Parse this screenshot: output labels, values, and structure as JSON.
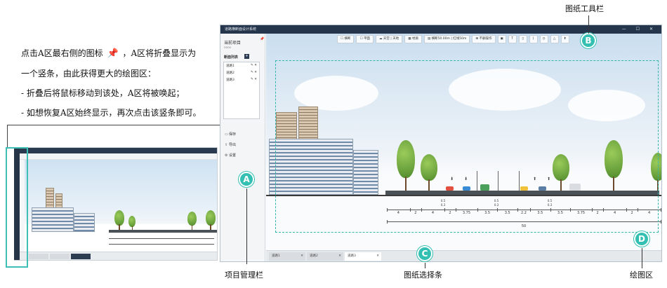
{
  "instructions": {
    "line1_prefix": "点击A区最右侧的图标",
    "line1_suffix": "，A区将折叠显示为",
    "line2": "一个竖条，由此获得更大的绘图区：",
    "line3": "- 折叠后将鼠标移动到该处，A区将被唤起；",
    "line4": "- 如想恢复A区始终显示，再次点击该竖条即可。"
  },
  "app": {
    "window_title": "道路横断面设计系统",
    "project": {
      "title": "当前项目",
      "subtitle": "none"
    },
    "list_header": "断面列表",
    "list_items": [
      "道路1",
      "道路2",
      "道路3"
    ],
    "menu": [
      {
        "icon": "save-icon",
        "label": "保存"
      },
      {
        "icon": "export-icon",
        "label": "导出"
      },
      {
        "icon": "settings-icon",
        "label": "设置"
      }
    ],
    "toolbar": {
      "opt1": "横断",
      "opt2": "平面",
      "sky": "天空 | 天地",
      "material": "材质",
      "size": "横断50.00m | 红线50m",
      "ops": "不删操作"
    },
    "tabs": [
      "道路1",
      "道路2",
      "道路3"
    ],
    "dimensions": {
      "segments": [
        "4",
        "2",
        "4",
        "2",
        "3.75",
        "3.5",
        "3.5",
        "2.2",
        "3.5",
        "3.5",
        "3.75",
        "2",
        "4",
        "2",
        "4"
      ],
      "small_marks": [
        "0.5",
        "0.3",
        "0.5",
        "0.3",
        "0.5",
        "0.3"
      ],
      "total": "50"
    }
  },
  "callouts": {
    "a": {
      "letter": "A",
      "label": "项目管理栏"
    },
    "b": {
      "letter": "B",
      "label": "图纸工具栏"
    },
    "c": {
      "letter": "C",
      "label": "图纸选择条"
    },
    "d": {
      "letter": "D",
      "label": "绘图区"
    }
  },
  "colors": {
    "accent": "#34bfb3",
    "titlebar": "#24354c",
    "arrow": "#36b48a"
  }
}
